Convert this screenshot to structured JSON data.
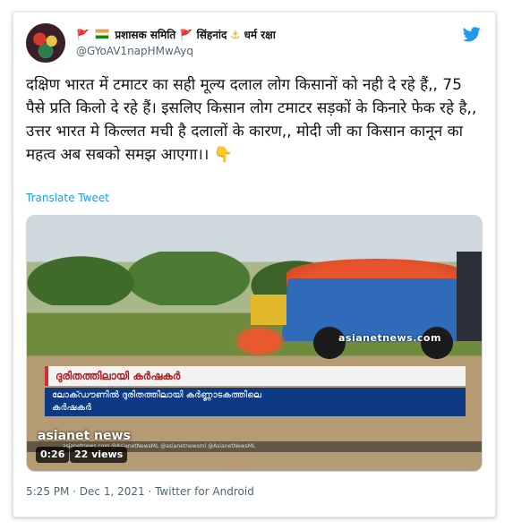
{
  "author": {
    "flag1": "🚩",
    "part1": "प्रशासक समिति",
    "flag2": "🚩",
    "part2": "सिंहनांद",
    "anchor": "⚓",
    "part3": "धर्म रक्षा",
    "handle": "@GYoAV1napHMwAyq"
  },
  "tweet": {
    "text": "दक्षिण भारत में टमाटर का सही मूल्य दलाल लोग किसानों को नही दे रहे हैं,, 75 पैसे प्रति किलो दे रहे हैं। इसलिए किसान लोग टमाटर सड़कों के किनारे फेक रहे है,, उत्तर भारत मे किल्लत मची है दलालों के कारण,, मोदी जी का किसान कानून का महत्व अब सबको समझ आएगा।। 👇",
    "translate_label": "Translate Tweet"
  },
  "video": {
    "watermark": "asianetnews.com",
    "headline": "ദുരിതത്തിലായി കർഷകർ",
    "subline1": "ലോക്ഡൗണിൽ ദുരിതത്തിലായി കർണ്ണാടകത്തിലെ",
    "subline2": "കർഷകർ",
    "logo": "asianet news",
    "footer_text": "asianetnews.com   @AsianetNewsML   @asianetnewsml   @AsianetNewsML",
    "duration": "0:26",
    "views": "22 views"
  },
  "meta": {
    "timestamp": "5:25 PM · Dec 1, 2021 · Twitter for Android"
  },
  "colors": {
    "accent": "#1d9bf0",
    "text": "#0f1419",
    "muted": "#536471"
  }
}
